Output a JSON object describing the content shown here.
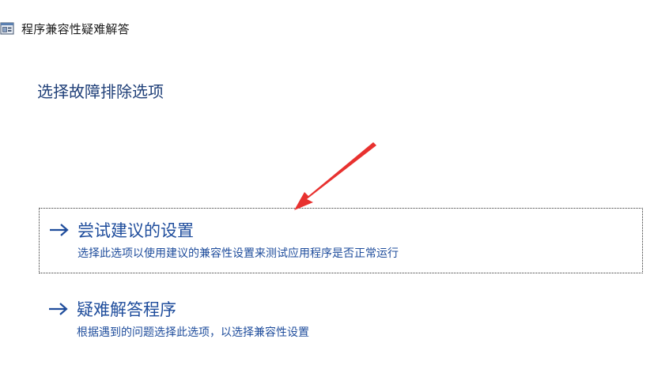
{
  "window": {
    "title": "程序兼容性疑难解答"
  },
  "page": {
    "heading": "选择故障排除选项"
  },
  "options": [
    {
      "label": "尝试建议的设置",
      "description": "选择此选项以使用建议的兼容性设置来测试应用程序是否正常运行"
    },
    {
      "label": "疑难解答程序",
      "description": "根据遇到的问题选择此选项，以选择兼容性设置"
    }
  ],
  "colors": {
    "accent": "#1f4d9c",
    "heading": "#1f3f78",
    "annotation": "#e8312f"
  }
}
